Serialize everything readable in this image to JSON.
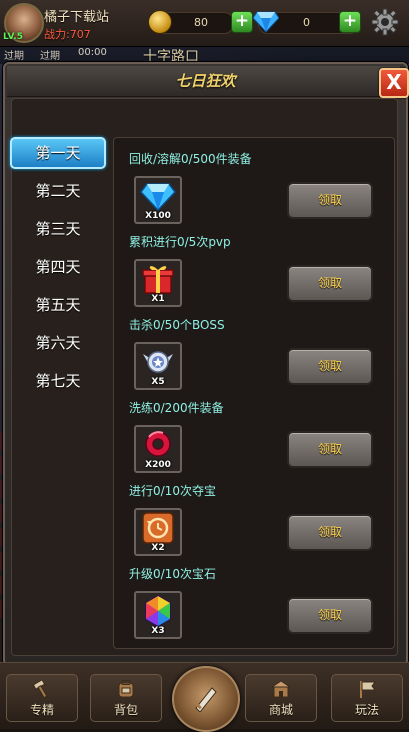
{
  "player": {
    "name": "橘子下载站",
    "power": "战力:707",
    "level": "LV.5"
  },
  "currency": {
    "coins": "80",
    "gems": "0"
  },
  "top": {
    "map_name": "十字路口",
    "left_text_1": "过期",
    "left_text_2": "过期",
    "timer": "00:00"
  },
  "modal": {
    "title": "七日狂欢",
    "close_glyph": "X"
  },
  "days": [
    {
      "label": "第一天",
      "active": true
    },
    {
      "label": "第二天",
      "active": false
    },
    {
      "label": "第三天",
      "active": false
    },
    {
      "label": "第四天",
      "active": false
    },
    {
      "label": "第五天",
      "active": false
    },
    {
      "label": "第六天",
      "active": false
    },
    {
      "label": "第七天",
      "active": false
    }
  ],
  "tasks": [
    {
      "desc": "回收/溶解0/500件装备",
      "reward_icon": "diamond-icon",
      "qty": "X100",
      "button": "领取"
    },
    {
      "desc": "累积进行0/5次pvp",
      "reward_icon": "gift-box-icon",
      "qty": "X1",
      "button": "领取"
    },
    {
      "desc": "击杀0/50个BOSS",
      "reward_icon": "winged-medal-icon",
      "qty": "X5",
      "button": "领取"
    },
    {
      "desc": "洗练0/200件装备",
      "reward_icon": "red-ring-icon",
      "qty": "X200",
      "button": "领取"
    },
    {
      "desc": "进行0/10次夺宝",
      "reward_icon": "refresh-badge-icon",
      "qty": "X2",
      "button": "领取"
    },
    {
      "desc": "升级0/10次宝石",
      "reward_icon": "rainbow-gem-icon",
      "qty": "X3",
      "button": "领取"
    }
  ],
  "bottom_nav": [
    {
      "label": "专精",
      "icon": "hammer-icon"
    },
    {
      "label": "背包",
      "icon": "backpack-icon"
    },
    {
      "label": "商城",
      "icon": "shop-icon"
    },
    {
      "label": "玩法",
      "icon": "flag-icon"
    }
  ],
  "colors": {
    "title_gold": "#f2d26a",
    "task_text": "#8ff0e2",
    "claim_text": "#ffd24a",
    "active_tab": "#2d9fe0",
    "power_red": "#ff5a3c"
  }
}
